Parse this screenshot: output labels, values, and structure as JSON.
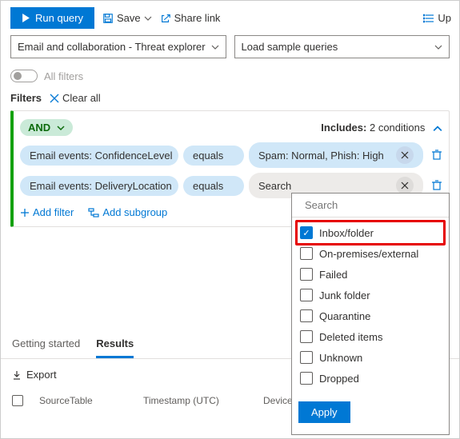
{
  "toolbar": {
    "run_label": "Run query",
    "save_label": "Save",
    "share_label": "Share link",
    "up_label": "Up"
  },
  "selectors": {
    "scope_label": "Email and collaboration - Threat explorer",
    "samples_label": "Load sample queries"
  },
  "all_filters_label": "All filters",
  "filters_section_label": "Filters",
  "clear_all_label": "Clear all",
  "filter_block": {
    "operator": "AND",
    "includes_label": "Includes:",
    "includes_count": "2 conditions",
    "conditions": [
      {
        "field": "Email events: ConfidenceLevel",
        "op": "equals",
        "value": "Spam: Normal, Phish: High"
      },
      {
        "field": "Email events: DeliveryLocation",
        "op": "equals",
        "value": "Search"
      }
    ],
    "add_filter_label": "Add filter",
    "add_subgroup_label": "Add subgroup"
  },
  "popup": {
    "search_placeholder": "Search",
    "options": [
      {
        "label": "Inbox/folder",
        "checked": true
      },
      {
        "label": "On-premises/external",
        "checked": false
      },
      {
        "label": "Failed",
        "checked": false
      },
      {
        "label": "Junk folder",
        "checked": false
      },
      {
        "label": "Quarantine",
        "checked": false
      },
      {
        "label": "Deleted items",
        "checked": false
      },
      {
        "label": "Unknown",
        "checked": false
      },
      {
        "label": "Dropped",
        "checked": false
      }
    ],
    "apply_label": "Apply"
  },
  "tabs": {
    "getting_started": "Getting started",
    "results": "Results"
  },
  "export_label": "Export",
  "table_columns": [
    "SourceTable",
    "Timestamp (UTC)",
    "DeviceId"
  ]
}
